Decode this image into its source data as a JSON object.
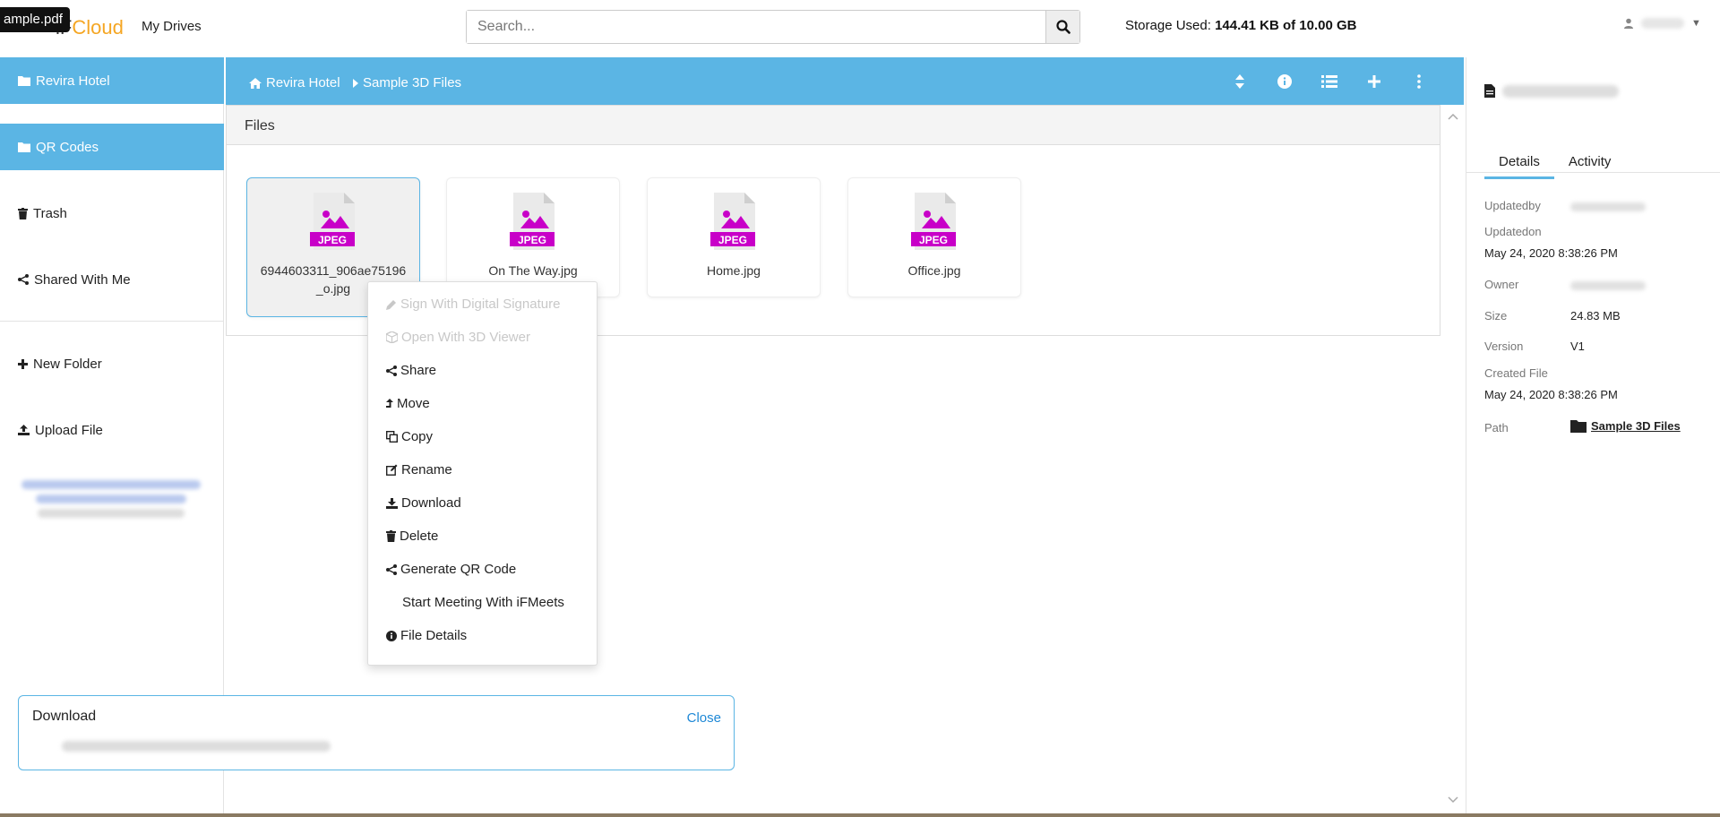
{
  "tooltip": "ample.pdf",
  "header": {
    "logo_prefix": "iF",
    "logo_c": "C",
    "logo_suffix": "loud",
    "my_drives": "My Drives",
    "search_placeholder": "Search...",
    "storage_label": "Storage Used:",
    "storage_value": "144.41 KB of 10.00 GB"
  },
  "sidebar": {
    "items": [
      {
        "label": "Revira Hotel",
        "icon": "folder-icon"
      },
      {
        "label": "QR Codes",
        "icon": "folder-icon"
      },
      {
        "label": "Trash",
        "icon": "trash-icon"
      },
      {
        "label": "Shared With Me",
        "icon": "share-icon"
      },
      {
        "label": "New Folder",
        "icon": "plus-icon"
      },
      {
        "label": "Upload File",
        "icon": "upload-icon"
      }
    ]
  },
  "breadcrumb": [
    {
      "label": "Revira Hotel",
      "icon": "home-icon"
    },
    {
      "label": "Sample 3D Files",
      "icon": "chevron-right-icon"
    }
  ],
  "files": {
    "header": "Files",
    "items": [
      {
        "name": "6944603311_906ae75196_o.jpg",
        "type": "JPEG"
      },
      {
        "name": "On The Way.jpg",
        "type": "JPEG"
      },
      {
        "name": "Home.jpg",
        "type": "JPEG"
      },
      {
        "name": "Office.jpg",
        "type": "JPEG"
      }
    ]
  },
  "context_menu": {
    "items": [
      {
        "label": "Sign With Digital Signature",
        "icon": "pencil-icon",
        "disabled": true
      },
      {
        "label": "Open With 3D Viewer",
        "icon": "cube-icon",
        "disabled": true
      },
      {
        "label": "Share",
        "icon": "share-icon",
        "disabled": false
      },
      {
        "label": "Move",
        "icon": "move-icon",
        "disabled": false
      },
      {
        "label": "Copy",
        "icon": "copy-icon",
        "disabled": false
      },
      {
        "label": "Rename",
        "icon": "edit-icon",
        "disabled": false
      },
      {
        "label": "Download",
        "icon": "download-icon",
        "disabled": false
      },
      {
        "label": "Delete",
        "icon": "trash-icon",
        "disabled": false
      },
      {
        "label": "Generate QR Code",
        "icon": "share-icon",
        "disabled": false
      },
      {
        "label": "Start Meeting With iFMeets",
        "icon": "",
        "disabled": false
      },
      {
        "label": "File Details",
        "icon": "info-icon",
        "disabled": false
      }
    ]
  },
  "details": {
    "tabs": [
      "Details",
      "Activity"
    ],
    "updatedby_label": "Updatedby",
    "updatedon_label": "Updatedon",
    "updatedon_value": "May 24, 2020 8:38:26 PM",
    "owner_label": "Owner",
    "size_label": "Size",
    "size_value": "24.83 MB",
    "version_label": "Version",
    "version_value": "V1",
    "created_label": "Created File",
    "created_value": "May 24, 2020 8:38:26 PM",
    "path_label": "Path",
    "path_value": "Sample 3D Files"
  },
  "toast": {
    "title": "Download",
    "close": "Close"
  },
  "colors": {
    "accent": "#5bb5e4",
    "jpeg": "#c800c8",
    "link": "#1e88d6"
  }
}
